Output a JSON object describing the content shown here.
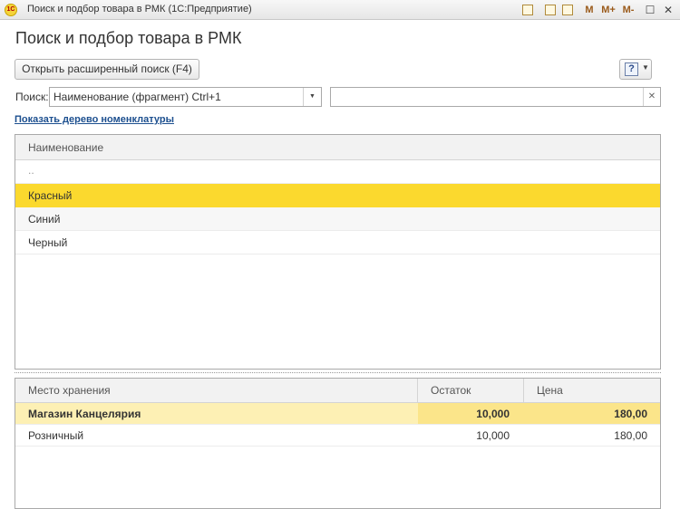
{
  "window": {
    "title": "Поиск и подбор товара в РМК  (1С:Предприятие)",
    "app_icon": "1c-icon",
    "buttons": [
      "M",
      "M+",
      "M-"
    ],
    "close_glyph": "✕",
    "minimize_glyph": "—",
    "maximize_glyph": "☐"
  },
  "header": {
    "title": "Поиск и подбор товара в РМК",
    "advanced_search_label": "Открыть расширенный поиск (F4)",
    "help_glyph": "?"
  },
  "search": {
    "label": "Поиск:",
    "mode_value": "Наименование (фрагмент) Ctrl+1",
    "text_value": "",
    "tree_link": "Показать дерево номенклатуры"
  },
  "items_table": {
    "column": "Наименование",
    "up_row": "..",
    "rows": [
      "Красный",
      "Синий",
      "Черный"
    ],
    "selected_index": 0
  },
  "stock_table": {
    "columns": [
      "Место хранения",
      "Остаток",
      "Цена"
    ],
    "rows": [
      {
        "place": "Магазин Канцелярия",
        "qty": "10,000",
        "price": "180,00"
      },
      {
        "place": "Розничный",
        "qty": "10,000",
        "price": "180,00"
      }
    ],
    "selected_index": 0
  },
  "colors": {
    "selected_row": "#fbd92e",
    "selected_row_light": "#fdf0b4",
    "link": "#1c4f8f"
  }
}
